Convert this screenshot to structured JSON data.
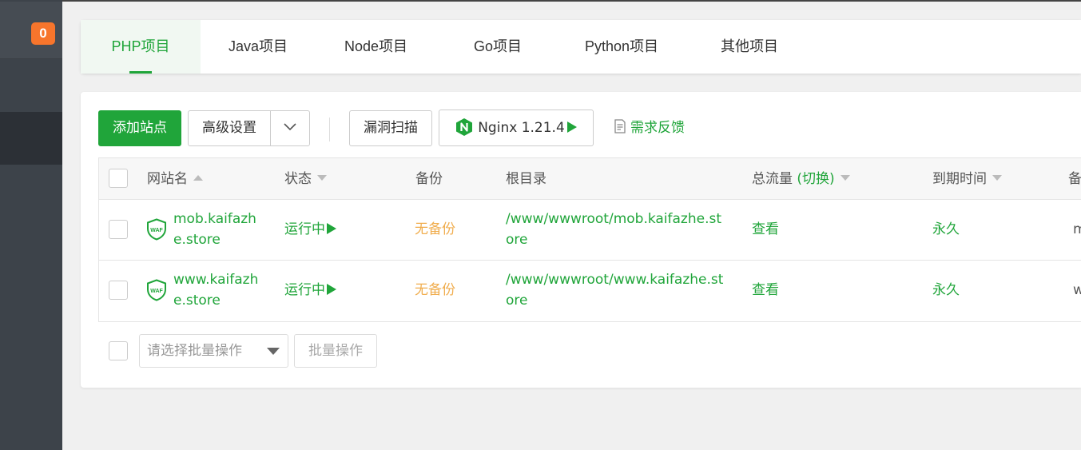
{
  "sidebar": {
    "badge_count": "0"
  },
  "tabs": [
    {
      "label": "PHP项目",
      "active": true
    },
    {
      "label": "Java项目",
      "active": false
    },
    {
      "label": "Node项目",
      "active": false
    },
    {
      "label": "Go项目",
      "active": false
    },
    {
      "label": "Python项目",
      "active": false
    },
    {
      "label": "其他项目",
      "active": false
    }
  ],
  "toolbar": {
    "add_site": "添加站点",
    "advanced_settings": "高级设置",
    "vuln_scan": "漏洞扫描",
    "nginx_label": "Nginx 1.21.4",
    "feedback": "需求反馈"
  },
  "table": {
    "headers": {
      "name": "网站名",
      "status": "状态",
      "backup": "备份",
      "root": "根目录",
      "traffic": "总流量",
      "traffic_switch": "(切换)",
      "expire": "到期时间",
      "note": "备"
    },
    "rows": [
      {
        "name_line1": "mob.kaifazh",
        "name_line2": "e.store",
        "status": "运行中",
        "backup": "无备份",
        "root_line1": "/www/wwwroot/mob.kaifazhe.st",
        "root_line2": "ore",
        "traffic": "查看",
        "expire": "永久",
        "note": "m"
      },
      {
        "name_line1": "www.kaifazh",
        "name_line2": "e.store",
        "status": "运行中",
        "backup": "无备份",
        "root_line1": "/www/wwwroot/www.kaifazhe.st",
        "root_line2": "ore",
        "traffic": "查看",
        "expire": "永久",
        "note": "w"
      }
    ]
  },
  "batch": {
    "select_placeholder": "请选择批量操作",
    "button": "批量操作"
  },
  "colors": {
    "accent": "#20a53a",
    "warning": "#f0ad4e",
    "badge": "#f7752c"
  },
  "icons": [
    "waf-shield-icon",
    "nginx-icon",
    "play-icon",
    "edit-note-icon",
    "chevron-down-icon",
    "sort-up-icon",
    "sort-down-icon"
  ]
}
